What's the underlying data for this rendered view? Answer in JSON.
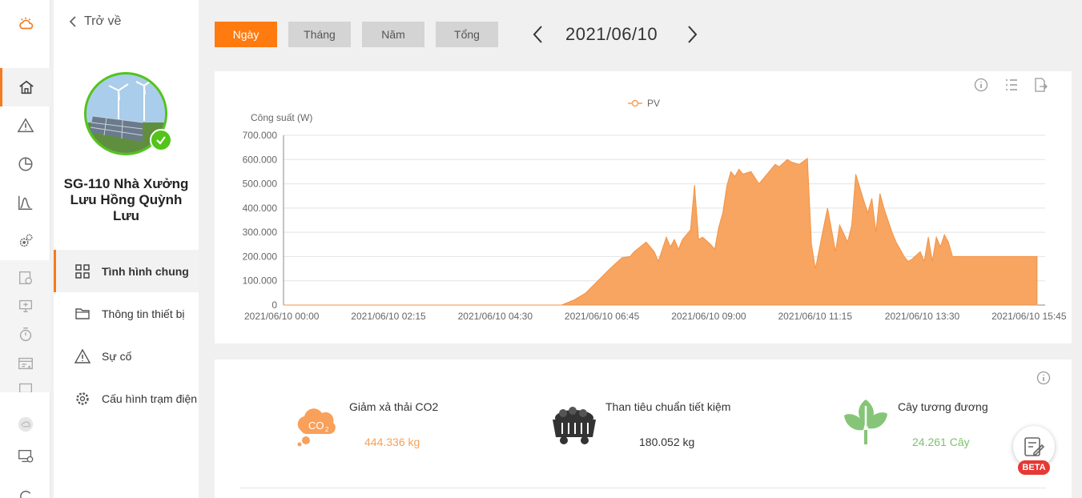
{
  "nav": {
    "back_label": "Trở về",
    "station_name": "SG-110 Nhà Xưởng Lưu Hồng Quỳnh Lưu",
    "items": [
      {
        "label": "Tình hình chung",
        "icon": "grid-icon",
        "active": true
      },
      {
        "label": "Thông tin thiết bị",
        "icon": "folder-icon",
        "active": false
      },
      {
        "label": "Sự cố",
        "icon": "warning-icon",
        "active": false
      },
      {
        "label": "Cấu hình trạm điện",
        "icon": "gear-icon",
        "active": false
      }
    ]
  },
  "rail": {
    "icons": [
      "logo-cloud-sun-icon",
      "home-icon",
      "alarm-icon",
      "pie-chart-icon",
      "curve-chart-icon",
      "settings-gears-icon",
      "report-icon",
      "monitor-icon",
      "timer-icon",
      "device-list-icon",
      "folder-link-icon",
      "cloud-icon",
      "device-settings-icon",
      "refresh-icon"
    ]
  },
  "period_tabs": [
    {
      "label": "Ngày",
      "active": true
    },
    {
      "label": "Tháng",
      "active": false
    },
    {
      "label": "Năm",
      "active": false
    },
    {
      "label": "Tổng",
      "active": false
    }
  ],
  "date_display": "2021/06/10",
  "chart_tools": [
    "info-icon",
    "list-icon",
    "export-icon"
  ],
  "chart_data": {
    "type": "area",
    "legend": [
      "PV"
    ],
    "legend_position": "top-center",
    "ylabel": "Công suất (W)",
    "ylim": [
      0,
      700000
    ],
    "yticks": [
      0,
      100000,
      200000,
      300000,
      400000,
      500000,
      600000,
      700000
    ],
    "ytick_labels": [
      "0",
      "100.000",
      "200.000",
      "300.000",
      "400.000",
      "500.000",
      "600.000",
      "700.000"
    ],
    "xtick_labels": [
      "2021/06/10 00:00",
      "2021/06/10 02:15",
      "2021/06/10 04:30",
      "2021/06/10 06:45",
      "2021/06/10 09:00",
      "2021/06/10 11:15",
      "2021/06/10 13:30",
      "2021/06/10 15:45"
    ],
    "grid": true,
    "color": "#f7a057",
    "series": [
      {
        "name": "PV",
        "x": [
          "00:00",
          "05:45",
          "06:00",
          "06:15",
          "06:30",
          "06:45",
          "07:00",
          "07:10",
          "07:15",
          "07:30",
          "07:40",
          "07:45",
          "07:55",
          "08:00",
          "08:05",
          "08:10",
          "08:15",
          "08:25",
          "08:30",
          "08:35",
          "08:40",
          "08:50",
          "08:55",
          "09:00",
          "09:05",
          "09:10",
          "09:15",
          "09:20",
          "09:25",
          "09:30",
          "09:40",
          "09:50",
          "10:00",
          "10:10",
          "10:15",
          "10:25",
          "10:30",
          "10:40",
          "10:50",
          "10:55",
          "11:00",
          "11:10",
          "11:15",
          "11:25",
          "11:30",
          "11:40",
          "11:45",
          "11:50",
          "12:00",
          "12:05",
          "12:10",
          "12:15",
          "12:20",
          "12:25",
          "12:35",
          "12:40",
          "12:45",
          "12:50",
          "12:55",
          "13:00",
          "13:10",
          "13:15",
          "13:20",
          "13:25",
          "13:30",
          "13:35",
          "13:40",
          "13:45",
          "13:50",
          "14:00",
          "14:10",
          "14:20",
          "14:30",
          "14:35",
          "14:45",
          "14:50",
          "14:55",
          "15:00",
          "15:05",
          "15:10",
          "15:15",
          "15:20",
          "15:25",
          "15:30",
          "15:35"
        ],
        "values": [
          0,
          0,
          20000,
          50000,
          100000,
          150000,
          195000,
          200000,
          220000,
          260000,
          220000,
          180000,
          280000,
          240000,
          270000,
          230000,
          270000,
          310000,
          495000,
          270000,
          280000,
          250000,
          230000,
          320000,
          380000,
          490000,
          550000,
          530000,
          560000,
          540000,
          550000,
          500000,
          540000,
          580000,
          570000,
          600000,
          590000,
          580000,
          605000,
          250000,
          150000,
          320000,
          400000,
          220000,
          330000,
          260000,
          330000,
          540000,
          430000,
          380000,
          440000,
          300000,
          460000,
          400000,
          300000,
          260000,
          230000,
          200000,
          180000,
          190000,
          220000,
          180000,
          280000,
          180000,
          280000,
          240000,
          290000,
          260000,
          200000,
          200000,
          200000,
          200000,
          200000,
          200000,
          200000,
          200000,
          200000,
          200000,
          200000,
          200000,
          200000,
          200000,
          200000,
          200000,
          200000
        ]
      }
    ]
  },
  "stats": [
    {
      "title": "Giảm xả thải CO2",
      "value": "444.336  kg",
      "icon": "co2-cloud-icon",
      "color": "#f7a057"
    },
    {
      "title": "Than tiêu chuẩn tiết kiệm",
      "value": "180.052  kg",
      "icon": "coal-cart-icon",
      "color": "#333333"
    },
    {
      "title": "Cây tương đương",
      "value": "24.261  Cây",
      "icon": "tree-icon",
      "color": "#7cc26b"
    }
  ],
  "beta_label": "BETA",
  "accent": "#ff7a0f"
}
